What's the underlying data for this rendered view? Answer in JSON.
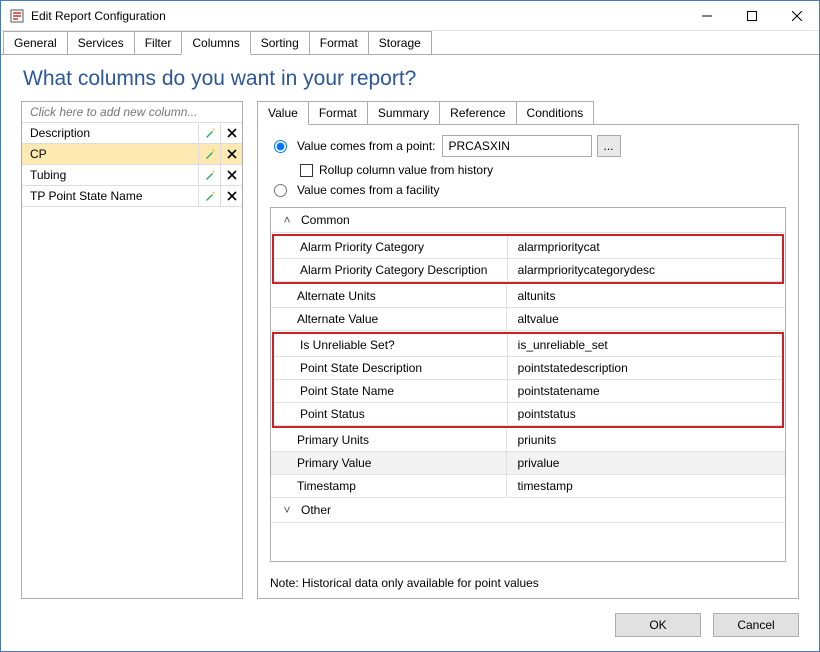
{
  "window": {
    "title": "Edit Report Configuration"
  },
  "main_tabs": [
    "General",
    "Services",
    "Filter",
    "Columns",
    "Sorting",
    "Format",
    "Storage"
  ],
  "main_tab_active": 3,
  "heading": "What columns do you want in your report?",
  "columns_list": {
    "placeholder": "Click here to add new column...",
    "items": [
      {
        "name": "Description",
        "edit_icon": "wand",
        "delete_icon": "x"
      },
      {
        "name": "CP",
        "edit_icon": "wand",
        "delete_icon": "x",
        "selected": true
      },
      {
        "name": "Tubing",
        "edit_icon": "wand",
        "delete_icon": "x"
      },
      {
        "name": "TP Point State Name",
        "edit_icon": "wand",
        "delete_icon": "x"
      }
    ]
  },
  "sub_tabs": [
    "Value",
    "Format",
    "Summary",
    "Reference",
    "Conditions"
  ],
  "sub_tab_active": 0,
  "value_source": {
    "point_label": "Value comes from a point:",
    "point_value": "PRCASXIN",
    "browse_label": "...",
    "rollup_label": "Rollup column value from history",
    "facility_label": "Value comes from a facility"
  },
  "groups": [
    {
      "name": "Common",
      "expanded": true
    },
    {
      "name": "Other",
      "expanded": false
    }
  ],
  "attrs_common": [
    {
      "label": "Alarm Priority Category",
      "value": "alarmprioritycat",
      "hl": 1
    },
    {
      "label": "Alarm Priority Category Description",
      "value": "alarmprioritycategorydesc",
      "hl": 1
    },
    {
      "label": "Alternate Units",
      "value": "altunits"
    },
    {
      "label": "Alternate Value",
      "value": "altvalue"
    },
    {
      "label": "Is Unreliable Set?",
      "value": "is_unreliable_set",
      "hl": 2
    },
    {
      "label": "Point State Description",
      "value": "pointstatedescription",
      "hl": 2
    },
    {
      "label": "Point State Name",
      "value": "pointstatename",
      "hl": 2
    },
    {
      "label": "Point Status",
      "value": "pointstatus",
      "hl": 2
    },
    {
      "label": "Primary Units",
      "value": "priunits"
    },
    {
      "label": "Primary Value",
      "value": "privalue",
      "sel": true
    },
    {
      "label": "Timestamp",
      "value": "timestamp"
    }
  ],
  "note": "Note: Historical data only available for point values",
  "buttons": {
    "ok": "OK",
    "cancel": "Cancel"
  }
}
